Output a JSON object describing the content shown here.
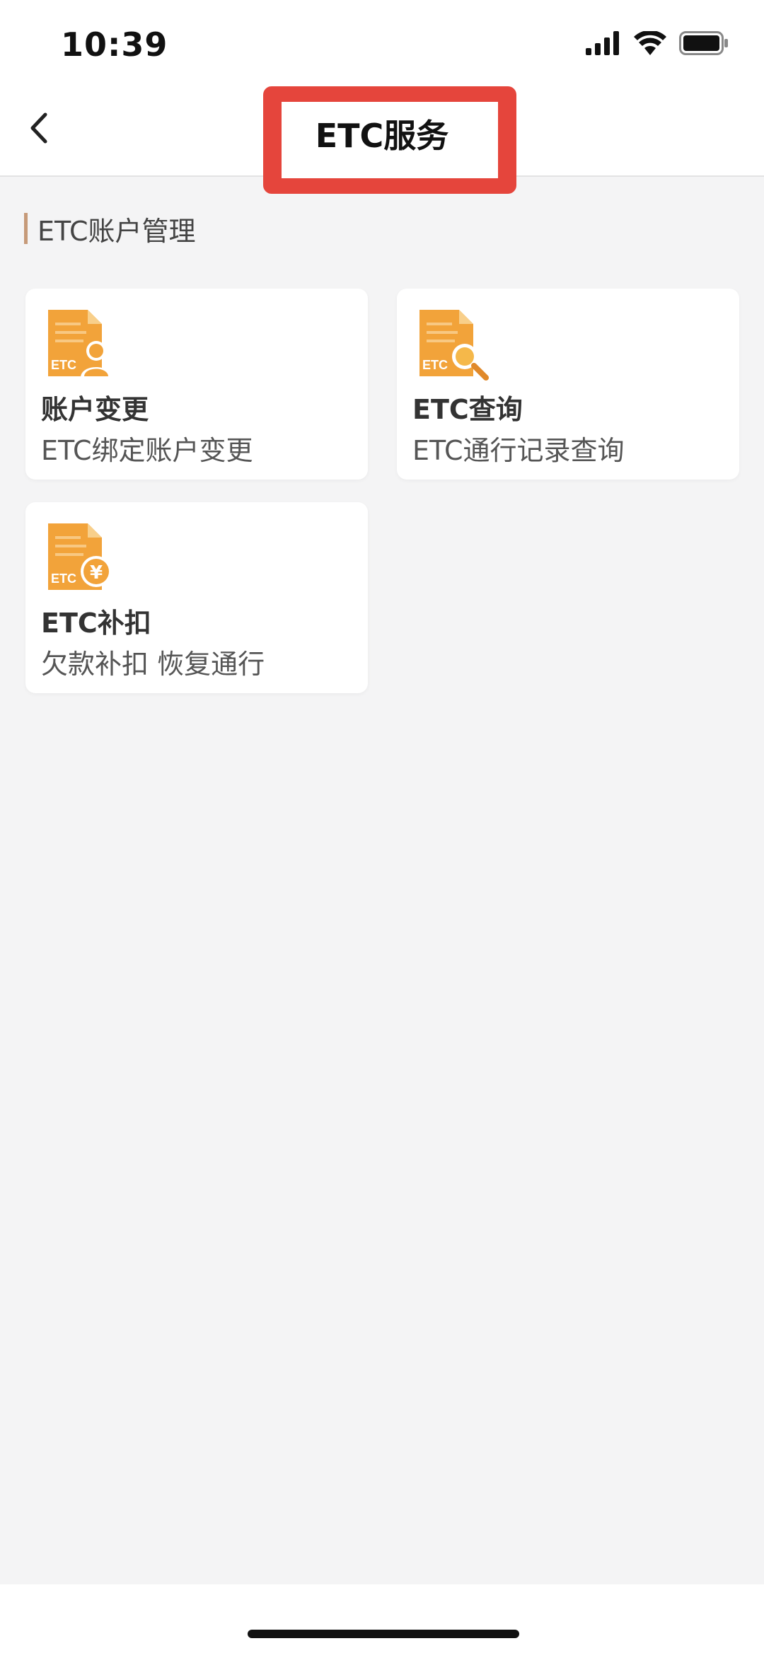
{
  "status_bar": {
    "time": "10:39"
  },
  "nav": {
    "title": "ETC服务",
    "back_icon": "chevron-left-icon",
    "highlight_color": "#e5453c"
  },
  "section": {
    "title": "ETC账户管理",
    "accent_color": "#c69a79"
  },
  "cards": [
    {
      "title": "账户变更",
      "desc": "ETC绑定账户变更",
      "icon": "etc-account-icon"
    },
    {
      "title": "ETC查询",
      "desc": "ETC通行记录查询",
      "icon": "etc-search-icon"
    },
    {
      "title": "ETC补扣",
      "desc": "欠款补扣 恢复通行",
      "icon": "etc-yuan-icon"
    }
  ],
  "icon_label": "ETC",
  "colors": {
    "icon_orange": "#f2a33a",
    "icon_dark_orange": "#e0892a",
    "background": "#f4f4f5"
  }
}
